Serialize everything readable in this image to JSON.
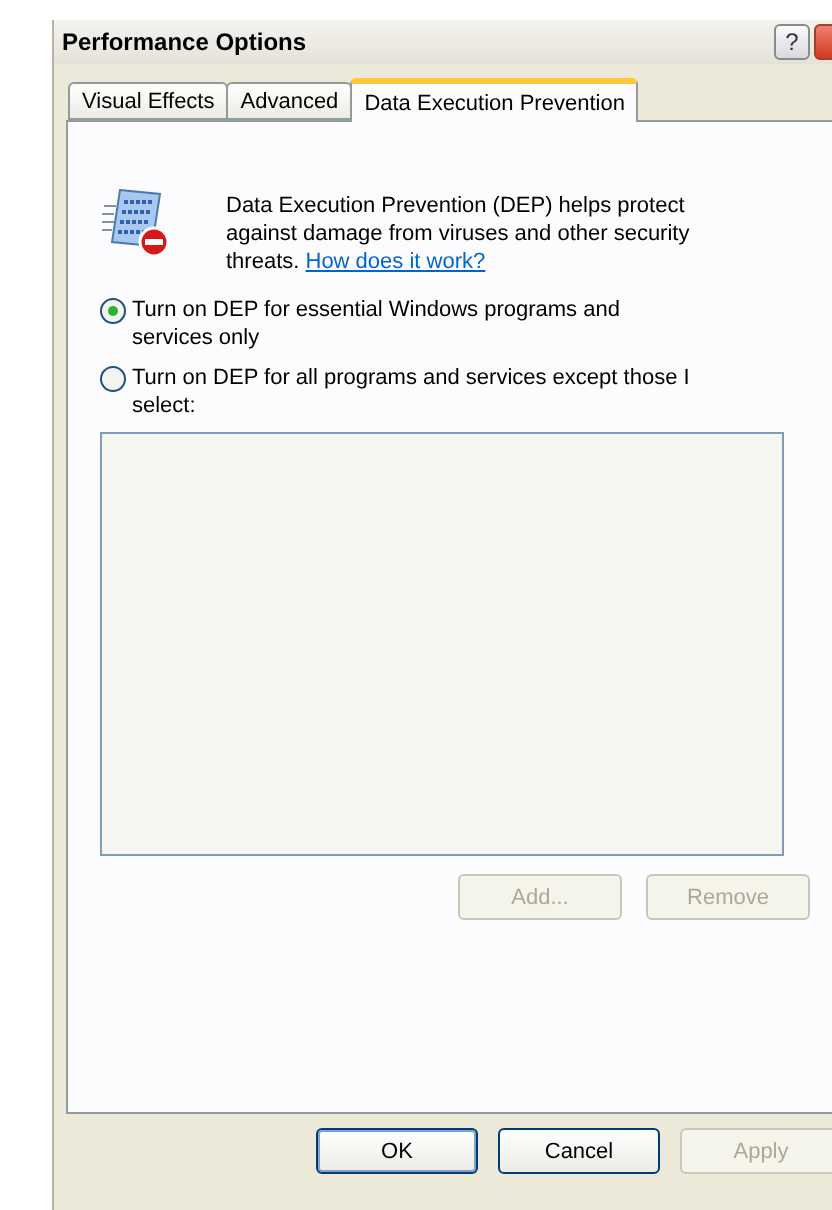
{
  "window": {
    "title": "Performance Options",
    "help_button": "?"
  },
  "tabs": [
    {
      "label": "Visual Effects",
      "selected": false
    },
    {
      "label": "Advanced",
      "selected": false
    },
    {
      "label": "Data Execution Prevention",
      "selected": true
    }
  ],
  "description": {
    "text": "Data Execution Prevention (DEP) helps protect against damage from viruses and other security threats.",
    "link": "How does it work?"
  },
  "options": [
    {
      "label": "Turn on DEP for essential Windows programs and services only",
      "selected": true
    },
    {
      "label": "Turn on DEP for all programs and services except those I select:",
      "selected": false
    }
  ],
  "list_buttons": [
    {
      "label": "Add...",
      "disabled": true
    },
    {
      "label": "Remove",
      "disabled": true
    }
  ],
  "dialog_buttons": [
    {
      "label": "OK",
      "disabled": false,
      "default": true
    },
    {
      "label": "Cancel",
      "disabled": false,
      "default": false
    },
    {
      "label": "Apply",
      "disabled": true,
      "default": false
    }
  ]
}
